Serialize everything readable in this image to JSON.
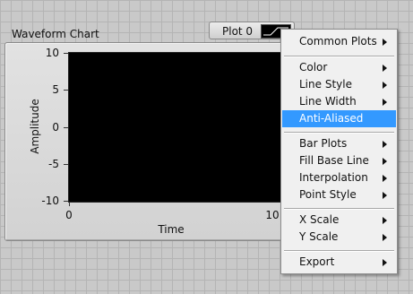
{
  "chart": {
    "title": "Waveform Chart",
    "y_axis_label": "Amplitude",
    "x_axis_label": "Time",
    "y_ticks": [
      "10",
      "5",
      "0",
      "-5",
      "-10"
    ],
    "x_ticks": [
      "0",
      "10"
    ],
    "legend_label": "Plot 0",
    "plot_background": "#000000"
  },
  "menu": {
    "items": [
      {
        "label": "Common Plots",
        "submenu": true
      },
      {
        "label": "Color",
        "submenu": true
      },
      {
        "label": "Line Style",
        "submenu": true
      },
      {
        "label": "Line Width",
        "submenu": true
      },
      {
        "label": "Anti-Aliased",
        "submenu": false,
        "selected": true
      },
      {
        "label": "Bar Plots",
        "submenu": true
      },
      {
        "label": "Fill Base Line",
        "submenu": true
      },
      {
        "label": "Interpolation",
        "submenu": true
      },
      {
        "label": "Point Style",
        "submenu": true
      },
      {
        "label": "X Scale",
        "submenu": true
      },
      {
        "label": "Y Scale",
        "submenu": true
      },
      {
        "label": "Export",
        "submenu": true
      }
    ],
    "highlight_color": "#3399ff"
  }
}
